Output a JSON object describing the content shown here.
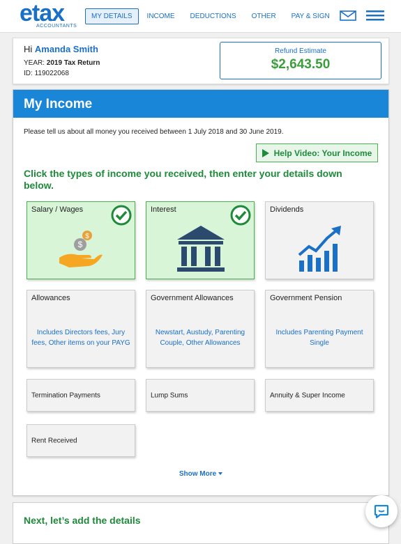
{
  "nav": {
    "logo_word": "etax",
    "logo_sub": "ACCOUNTANTS",
    "links": [
      "MY DETAILS",
      "INCOME",
      "DEDUCTIONS",
      "OTHER",
      "PAY & SIGN"
    ],
    "icons": [
      "mail-icon",
      "menu-icon"
    ]
  },
  "header": {
    "greeting": "Hi",
    "name": "Amanda Smith",
    "year_label": "YEAR:",
    "year_value": "2019 Tax Return",
    "id_label": "ID:",
    "id_value": "119022068",
    "refund_label": "Refund Estimate",
    "refund_amount": "$2,643.50"
  },
  "main": {
    "title": "My Income",
    "intro": "Please tell us about all money you received between 1 July 2018 and 30 June 2019.",
    "help_button": "Help Video: Your Income",
    "instruction": "Click the types of income you received, then enter your details down below.",
    "tiles": [
      {
        "label": "Salary / Wages",
        "selected": true,
        "icon": "salary-hand-coins-icon"
      },
      {
        "label": "Interest",
        "selected": true,
        "icon": "bank-building-icon"
      },
      {
        "label": "Dividends",
        "selected": false,
        "icon": "growth-chart-icon"
      },
      {
        "label": "Allowances",
        "selected": false,
        "desc": "Includes Directors fees, Jury fees, Other items on your PAYG"
      },
      {
        "label": "Government Allowances",
        "selected": false,
        "desc": "Newstart, Austudy, Parenting Couple, Other Allowances"
      },
      {
        "label": "Government Pension",
        "selected": false,
        "desc": "Includes Parenting Payment Single"
      },
      {
        "label": "Termination Payments",
        "selected": false
      },
      {
        "label": "Lump Sums",
        "selected": false
      },
      {
        "label": "Annuity & Super Income",
        "selected": false
      },
      {
        "label": "Rent Received",
        "selected": false
      }
    ],
    "show_more": "Show More"
  },
  "next": {
    "title": "Next, let’s add the details"
  },
  "colors": {
    "brand_blue": "#1a6fc7",
    "header_blue": "#1a86d8",
    "green": "#1e8a3a",
    "selected_bg": "#d8f5d8"
  }
}
